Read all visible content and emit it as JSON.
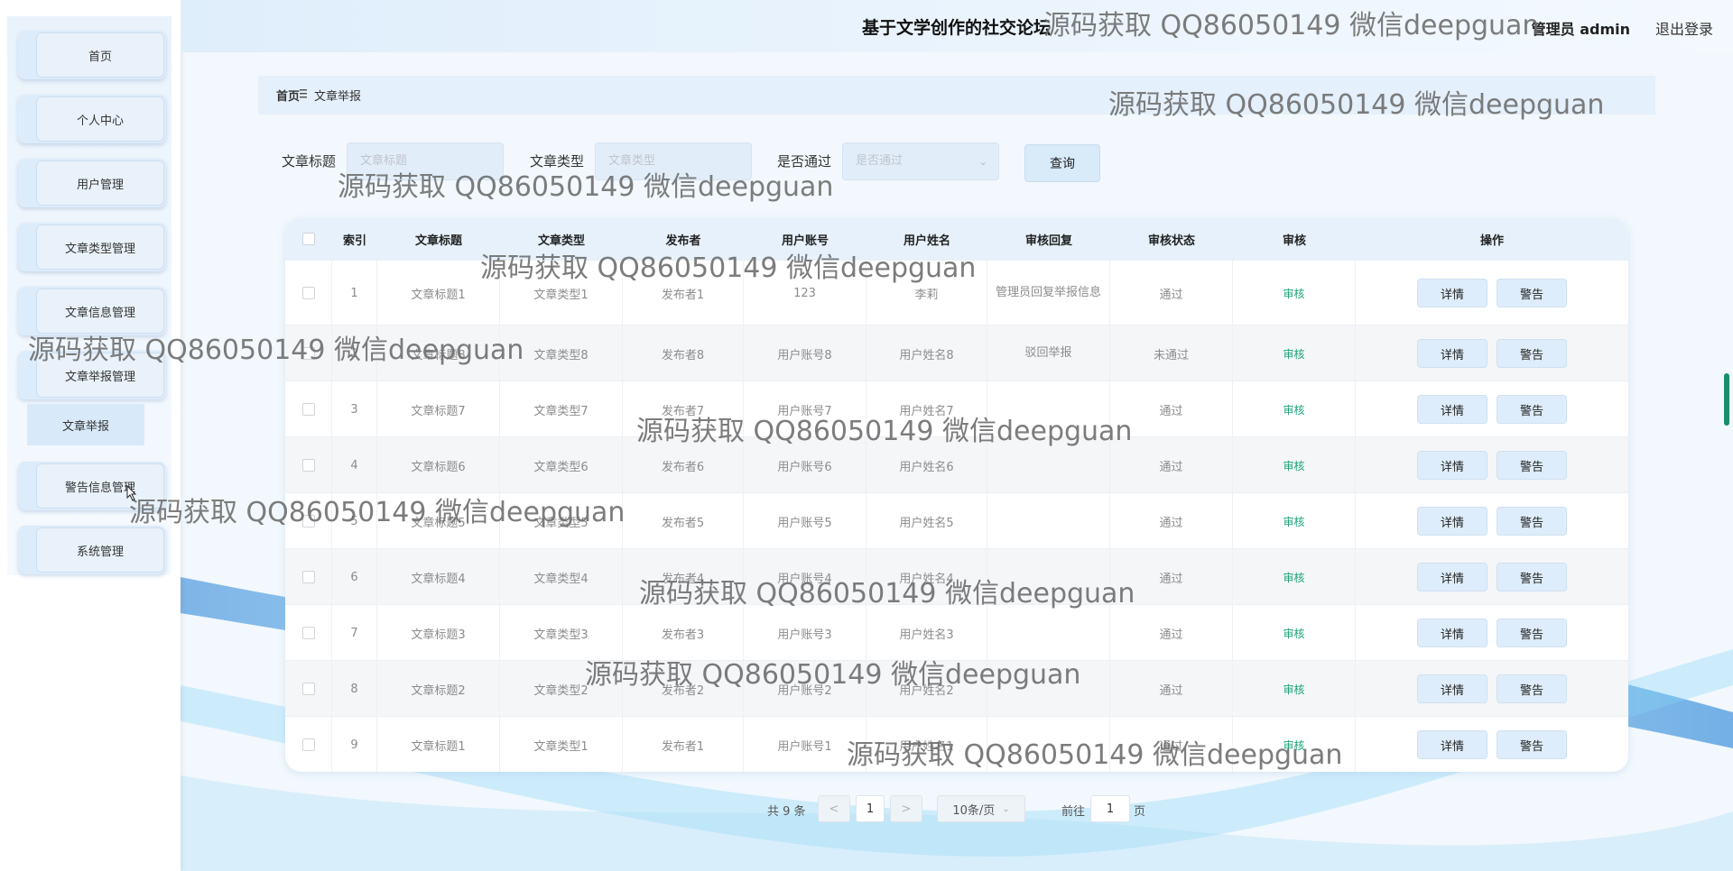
{
  "header": {
    "site_title": "基于文学创作的社交论坛",
    "user_info": "管理员 admin",
    "logout_label": "退出登录"
  },
  "sidebar": {
    "items": [
      {
        "label": "首页"
      },
      {
        "label": "个人中心"
      },
      {
        "label": "用户管理"
      },
      {
        "label": "文章类型管理"
      },
      {
        "label": "文章信息管理"
      },
      {
        "label": "文章举报管理"
      },
      {
        "label": "警告信息管理"
      },
      {
        "label": "系统管理"
      }
    ],
    "submenu_label": "文章举报"
  },
  "breadcrumb": {
    "home": "首页",
    "separator_icon": "menu-lines-icon",
    "current": "文章举报"
  },
  "filters": {
    "title_label": "文章标题",
    "title_placeholder": "文章标题",
    "type_label": "文章类型",
    "type_placeholder": "文章类型",
    "pass_label": "是否通过",
    "pass_placeholder": "是否通过",
    "query_label": "查询"
  },
  "table": {
    "columns": [
      "索引",
      "文章标题",
      "文章类型",
      "发布者",
      "用户账号",
      "用户姓名",
      "审核回复",
      "审核状态",
      "审核",
      "操作"
    ],
    "rows": [
      {
        "index": "1",
        "title": "文章标题1",
        "type": "文章类型1",
        "publisher": "发布者1",
        "account": "123",
        "name": "李莉",
        "reply": "管理员回复举报信息",
        "status": "通过",
        "audit": "审核"
      },
      {
        "index": "2",
        "title": "文章标题8",
        "type": "文章类型8",
        "publisher": "发布者8",
        "account": "用户账号8",
        "name": "用户姓名8",
        "reply": "驳回举报",
        "status": "未通过",
        "audit": "审核"
      },
      {
        "index": "3",
        "title": "文章标题7",
        "type": "文章类型7",
        "publisher": "发布者7",
        "account": "用户账号7",
        "name": "用户姓名7",
        "reply": "",
        "status": "通过",
        "audit": "审核"
      },
      {
        "index": "4",
        "title": "文章标题6",
        "type": "文章类型6",
        "publisher": "发布者6",
        "account": "用户账号6",
        "name": "用户姓名6",
        "reply": "",
        "status": "通过",
        "audit": "审核"
      },
      {
        "index": "5",
        "title": "文章标题5",
        "type": "文章类型5",
        "publisher": "发布者5",
        "account": "用户账号5",
        "name": "用户姓名5",
        "reply": "",
        "status": "通过",
        "audit": "审核"
      },
      {
        "index": "6",
        "title": "文章标题4",
        "type": "文章类型4",
        "publisher": "发布者4",
        "account": "用户账号4",
        "name": "用户姓名4",
        "reply": "",
        "status": "通过",
        "audit": "审核"
      },
      {
        "index": "7",
        "title": "文章标题3",
        "type": "文章类型3",
        "publisher": "发布者3",
        "account": "用户账号3",
        "name": "用户姓名3",
        "reply": "",
        "status": "通过",
        "audit": "审核"
      },
      {
        "index": "8",
        "title": "文章标题2",
        "type": "文章类型2",
        "publisher": "发布者2",
        "account": "用户账号2",
        "name": "用户姓名2",
        "reply": "",
        "status": "通过",
        "audit": "审核"
      },
      {
        "index": "9",
        "title": "文章标题1",
        "type": "文章类型1",
        "publisher": "发布者1",
        "account": "用户账号1",
        "name": "用户姓名1",
        "reply": "",
        "status": "通过",
        "audit": "审核"
      }
    ],
    "detail_label": "详情",
    "warn_label": "警告"
  },
  "pagination": {
    "total_text": "共 9 条",
    "prev_icon": "chevron-left-icon",
    "current_page": "1",
    "next_icon": "chevron-right-icon",
    "page_size": "10条/页",
    "goto_label": "前往",
    "goto_value": "1",
    "page_unit": "页"
  },
  "watermark": "源码获取 QQ86050149 微信deepguan",
  "colors": {
    "accent": "#dbeafa",
    "audit_green": "#1aa37a",
    "sidebar_item": "#dcecfb"
  }
}
